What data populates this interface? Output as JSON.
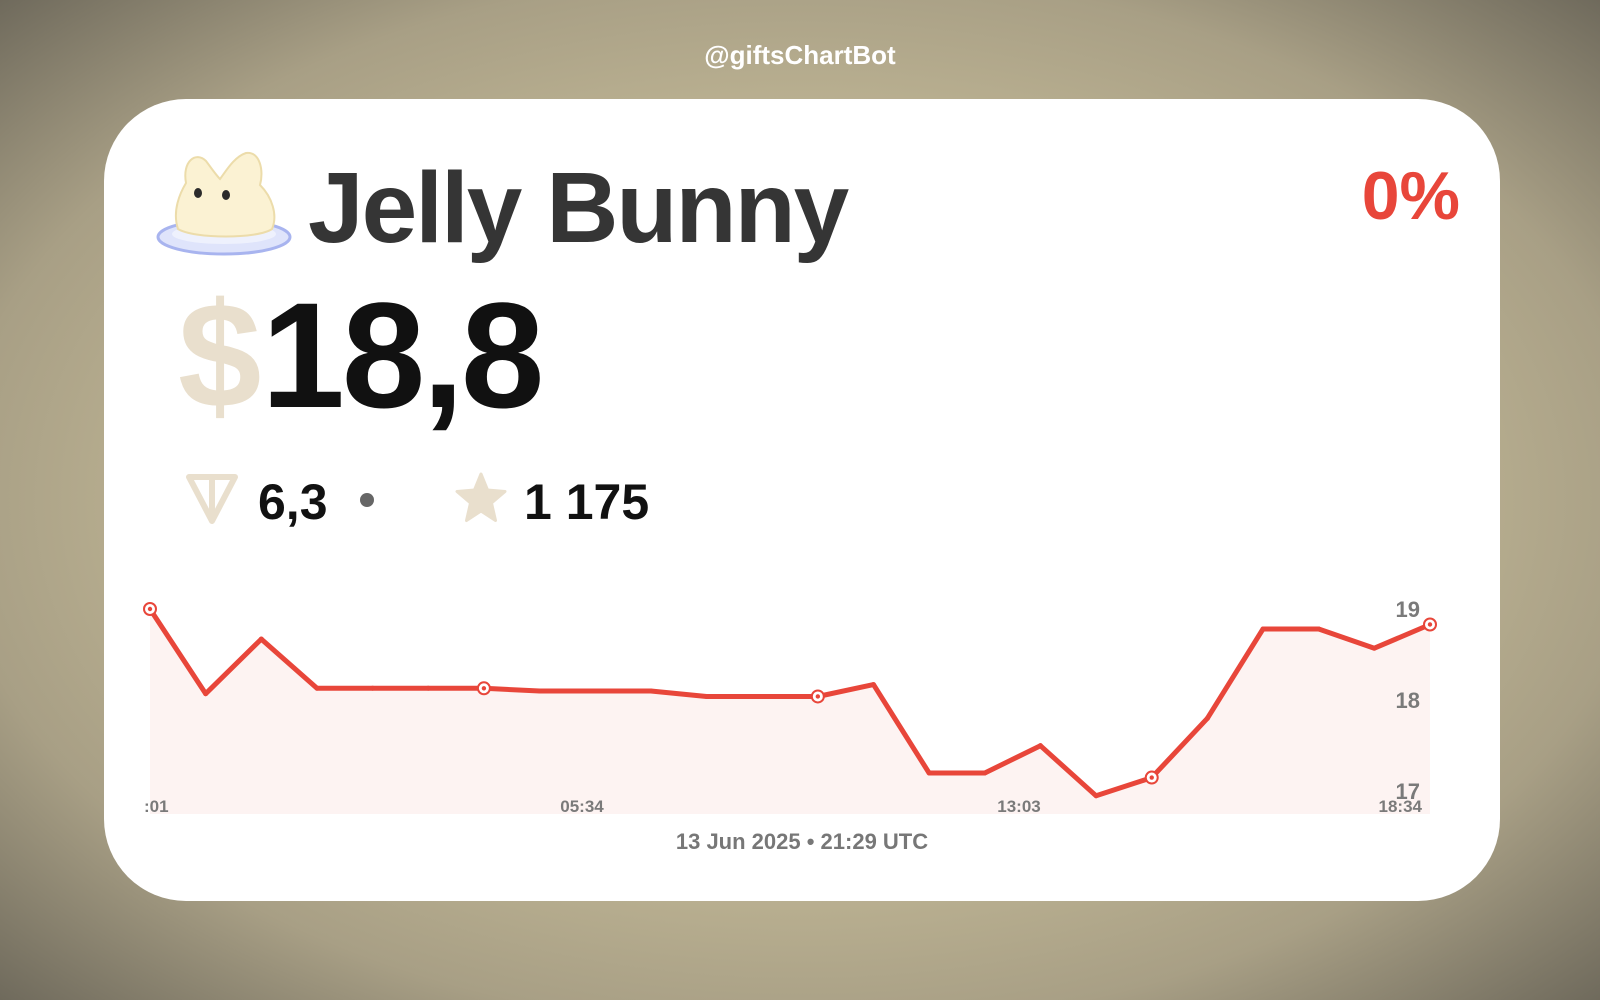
{
  "header": {
    "brand": "@giftsChartBot"
  },
  "gift": {
    "name": "Jelly Bunny",
    "icon": "jelly-bunny-icon",
    "change": "0%",
    "currency_symbol": "$",
    "price": "18,8",
    "ton_price": "6,3",
    "star_price": "1 175"
  },
  "colors": {
    "accent": "#e8463a",
    "currency": "#e9dfcd",
    "text": "#111111",
    "title": "#353535",
    "fill": "#fdf3f2"
  },
  "footer": {
    "timestamp": "13 Jun 2025 • 21:29 UTC"
  },
  "chart_data": {
    "type": "area",
    "x_ticks": [
      ":01",
      "05:34",
      "13:03",
      "18:34"
    ],
    "y_ticks": [
      17,
      18,
      19
    ],
    "ylim": [
      16.75,
      19
    ],
    "values": [
      19.0,
      18.07,
      18.67,
      18.13,
      18.13,
      18.13,
      18.13,
      18.1,
      18.1,
      18.1,
      18.04,
      18.04,
      18.04,
      18.17,
      17.2,
      17.2,
      17.5,
      16.95,
      17.15,
      17.8,
      18.78,
      18.78,
      18.57,
      18.83
    ],
    "marked_points": [
      0,
      6,
      12,
      18,
      23
    ],
    "grid": false,
    "legend": "none"
  }
}
